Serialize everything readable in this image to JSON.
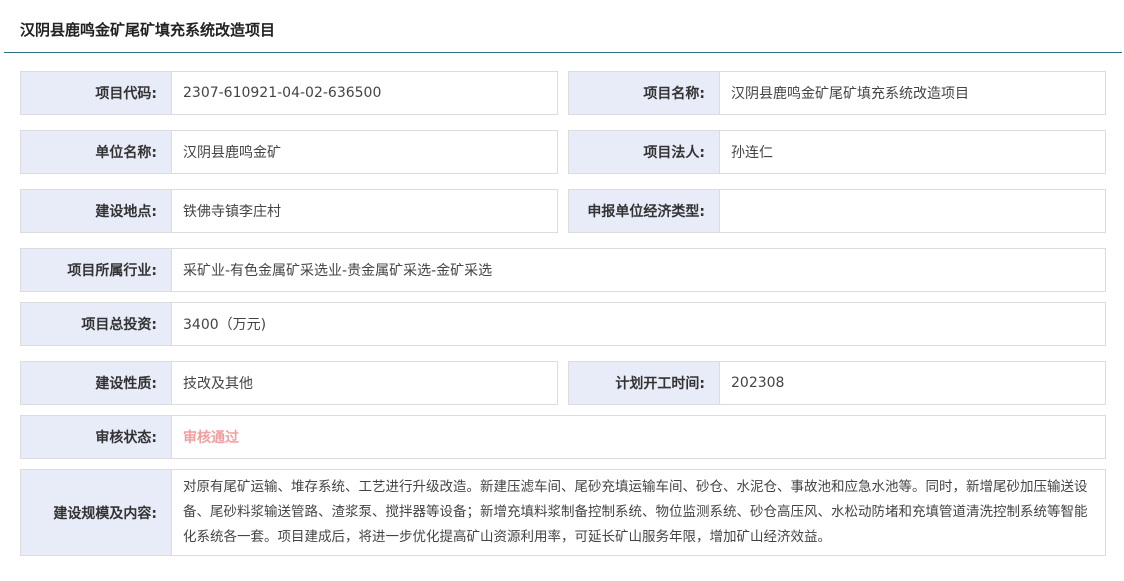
{
  "page": {
    "title": "汉阴县鹿鸣金矿尾矿填充系统改造项目"
  },
  "fields": {
    "project_code": {
      "label": "项目代码:",
      "value": "2307-610921-04-02-636500"
    },
    "project_name": {
      "label": "项目名称:",
      "value": "汉阴县鹿鸣金矿尾矿填充系统改造项目"
    },
    "unit_name": {
      "label": "单位名称:",
      "value": "汉阴县鹿鸣金矿"
    },
    "legal_person": {
      "label": "项目法人:",
      "value": "孙连仁"
    },
    "location": {
      "label": "建设地点:",
      "value": "铁佛寺镇李庄村"
    },
    "economic_type": {
      "label": "申报单位经济类型:",
      "value": ""
    },
    "industry": {
      "label": "项目所属行业:",
      "value": "采矿业-有色金属矿采选业-贵金属矿采选-金矿采选"
    },
    "total_investment": {
      "label": "项目总投资:",
      "value": "3400（万元)"
    },
    "construction_nature": {
      "label": "建设性质:",
      "value": "技改及其他"
    },
    "planned_start": {
      "label": "计划开工时间:",
      "value": "202308"
    },
    "review_status": {
      "label": "审核状态:",
      "value": "审核通过",
      "color": "#f0a0a0"
    },
    "scale_content": {
      "label": "建设规模及内容:",
      "value": "对原有尾矿运输、堆存系统、工艺进行升级改造。新建压滤车间、尾砂充填运输车间、砂仓、水泥仓、事故池和应急水池等。同时，新增尾砂加压输送设备、尾砂料浆输送管路、渣浆泵、搅拌器等设备；新增充填料浆制备控制系统、物位监测系统、砂仓高压风、水松动防堵和充填管道清洗控制系统等智能化系统各一套。项目建成后，将进一步优化提高矿山资源利用率，可延长矿山服务年限，增加矿山经济效益。"
    }
  },
  "colors": {
    "label_bg": "#e8ecf8",
    "border": "#dcdcdc",
    "divider": "#2e6f84"
  }
}
